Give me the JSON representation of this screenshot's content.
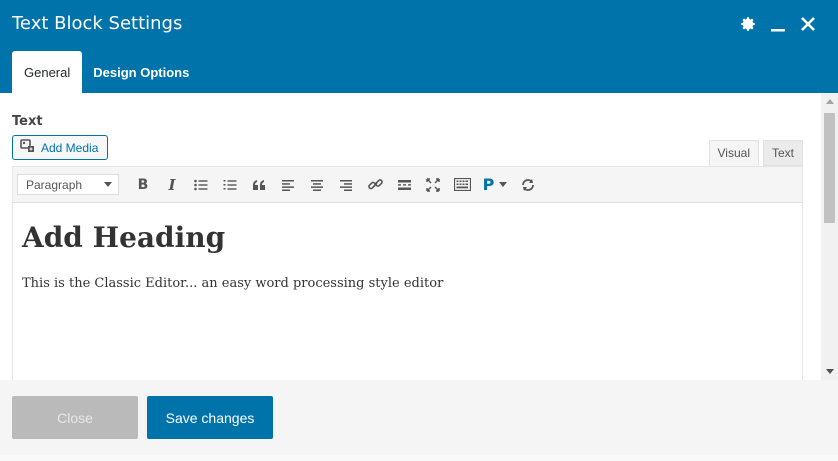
{
  "dialog": {
    "title": "Text Block Settings",
    "tabs": [
      {
        "label": "General",
        "active": true
      },
      {
        "label": "Design Options",
        "active": false
      }
    ]
  },
  "header_icons": [
    "gear-icon",
    "minimize-icon",
    "close-icon"
  ],
  "field": {
    "label": "Text",
    "add_media_label": "Add Media"
  },
  "editor": {
    "mode_tabs": [
      {
        "label": "Visual",
        "active": true
      },
      {
        "label": "Text",
        "active": false
      }
    ],
    "format_select": "Paragraph",
    "toolbar_icons": [
      "bold-icon",
      "italic-icon",
      "bullet-list-icon",
      "numbered-list-icon",
      "blockquote-icon",
      "align-left-icon",
      "align-center-icon",
      "align-right-icon",
      "link-icon",
      "read-more-icon",
      "fullscreen-icon",
      "toolbar-toggle-icon",
      "paragraph-icon",
      "undo-redo-icon"
    ],
    "heading": "Add Heading",
    "paragraph": "This is the Classic Editor... an easy word processing style editor"
  },
  "footer": {
    "close_label": "Close",
    "save_label": "Save changes"
  },
  "colors": {
    "header": "#0073aa",
    "save_button": "#0073aa",
    "close_button": "#bababa"
  }
}
